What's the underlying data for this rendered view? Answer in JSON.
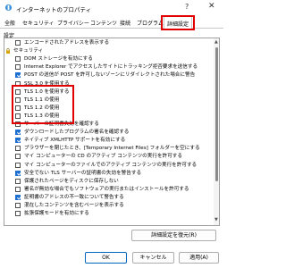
{
  "window": {
    "title": "インターネットのプロパティ",
    "help_glyph": "?",
    "close_glyph": "✕"
  },
  "tabs": [
    {
      "label": "全般"
    },
    {
      "label": "セキュリティ"
    },
    {
      "label": "プライバシー"
    },
    {
      "label": "コンテンツ"
    },
    {
      "label": "接続"
    },
    {
      "label": "プログラム"
    },
    {
      "label": "詳細設定"
    }
  ],
  "active_tab": "詳細設定",
  "settings_label": "設定",
  "settings_items": [
    {
      "label": "エンコードされたアドレスを表示する",
      "checked": false,
      "type": "checkbox"
    },
    {
      "label": "セキュリティ",
      "type": "group"
    },
    {
      "label": "DOM ストレージを有効にする",
      "checked": false,
      "type": "checkbox"
    },
    {
      "label": "Internet Explorer でアクセスしたサイトにトラッキング拒否要求を送信する",
      "checked": false,
      "type": "checkbox"
    },
    {
      "label": "POST の送信が POST を許可しないゾーンにリダイレクトされた場合に警告",
      "checked": true,
      "type": "checkbox"
    },
    {
      "label": "SSL 3.0 を使用する",
      "checked": false,
      "type": "checkbox"
    },
    {
      "label": "TLS 1.0 を使用する",
      "checked": false,
      "type": "checkbox"
    },
    {
      "label": "TLS 1.1 の使用",
      "checked": false,
      "type": "checkbox"
    },
    {
      "label": "TLS 1.2 の使用",
      "checked": false,
      "type": "checkbox"
    },
    {
      "label": "TLS 1.3 の使用",
      "checked": false,
      "type": "checkbox"
    },
    {
      "label": "サーバーの証明書失効を確認する",
      "checked": false,
      "type": "checkbox"
    },
    {
      "label": "ダウンロードしたプログラムの署名を確認する",
      "checked": true,
      "type": "checkbox"
    },
    {
      "label": "ネイティブ XMLHTTP サポートを有効にする",
      "checked": true,
      "type": "checkbox"
    },
    {
      "label": "ブラウザーを閉じたとき、[Temporary Internet Files] フォルダーを空にする",
      "checked": false,
      "type": "checkbox"
    },
    {
      "label": "マイ コンピューターの CD のアクティブ コンテンツの実行を許可する",
      "checked": false,
      "type": "checkbox"
    },
    {
      "label": "マイ コンピューターのファイルでのアクティブ コンテンツの実行を許可する",
      "checked": false,
      "type": "checkbox"
    },
    {
      "label": "安全でない TLS サーバーの証明書の失効を警告する",
      "checked": true,
      "type": "checkbox"
    },
    {
      "label": "保護されたページをディスクに保存しない",
      "checked": false,
      "type": "checkbox"
    },
    {
      "label": "署名が無効な場合でもソフトウェアの実行またはインストールを許可する",
      "checked": false,
      "type": "checkbox"
    },
    {
      "label": "証明書のアドレスの不一致について警告する",
      "checked": true,
      "type": "checkbox"
    },
    {
      "label": "混在したコンテンツを含むページを表示する",
      "checked": false,
      "type": "checkbox"
    },
    {
      "label": "拡張保護モードを有効にする",
      "checked": false,
      "type": "checkbox"
    }
  ],
  "buttons": {
    "reset_settings": "詳細設定を復元(R)",
    "ok": "OK",
    "cancel": "キャンセル",
    "apply": "適用(A)"
  },
  "colors": {
    "highlight": "#e00000",
    "checkbox_checked": "#1f6fd0",
    "primary_border": "#0067c0"
  }
}
